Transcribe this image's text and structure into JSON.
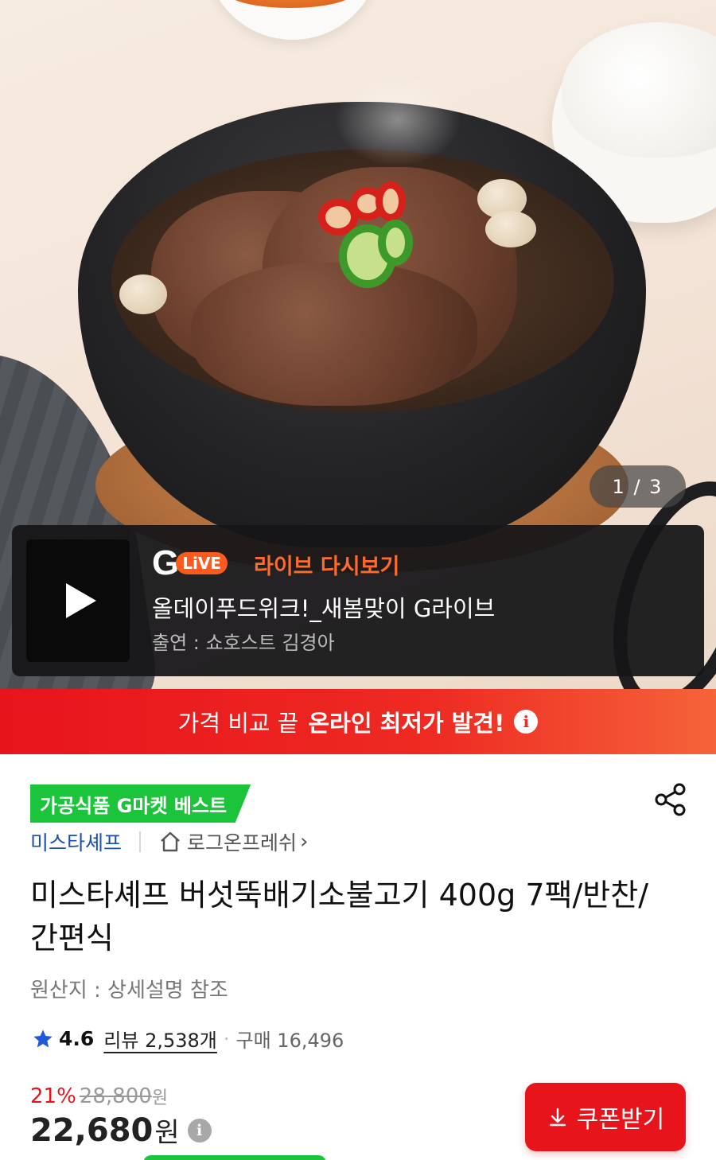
{
  "hero": {
    "image_desc_icon": "product-photo-bulgogi",
    "page_counter": "1 / 3"
  },
  "live": {
    "logo_g": "G",
    "logo_live": "LiVE",
    "replay_label": "라이브 다시보기",
    "title": "올데이푸드위크!_새봄맞이 G라이브",
    "cast": "출연 : 쇼호스트 김경아",
    "play_icon": "play-icon"
  },
  "promo": {
    "text_normal": "가격 비교 끝",
    "text_bold": "온라인 최저가 발견!",
    "info_glyph": "i"
  },
  "product": {
    "badge": "가공식품 G마켓 베스트",
    "seller": "미스타셰프",
    "store": "로그온프레쉬",
    "store_chevron": "›",
    "title": "미스타셰프 버섯뚝배기소불고기 400g 7팩/반찬/간편식",
    "origin": "원산지 : 상세설명 참조",
    "rating": "4.6",
    "review": "리뷰 2,538개",
    "separator": "·",
    "purchase": "구매 16,496",
    "discount": "21%",
    "original_price": "28,800",
    "original_won": "원",
    "price": "22,680",
    "price_won": "원",
    "price_info": "i",
    "coupon_label": "쿠폰받기"
  },
  "colors": {
    "accent_red": "#e8141c",
    "best_green": "#1cc43b",
    "seller_blue": "#1a4fb0",
    "live_orange": "#ff6b2c"
  }
}
